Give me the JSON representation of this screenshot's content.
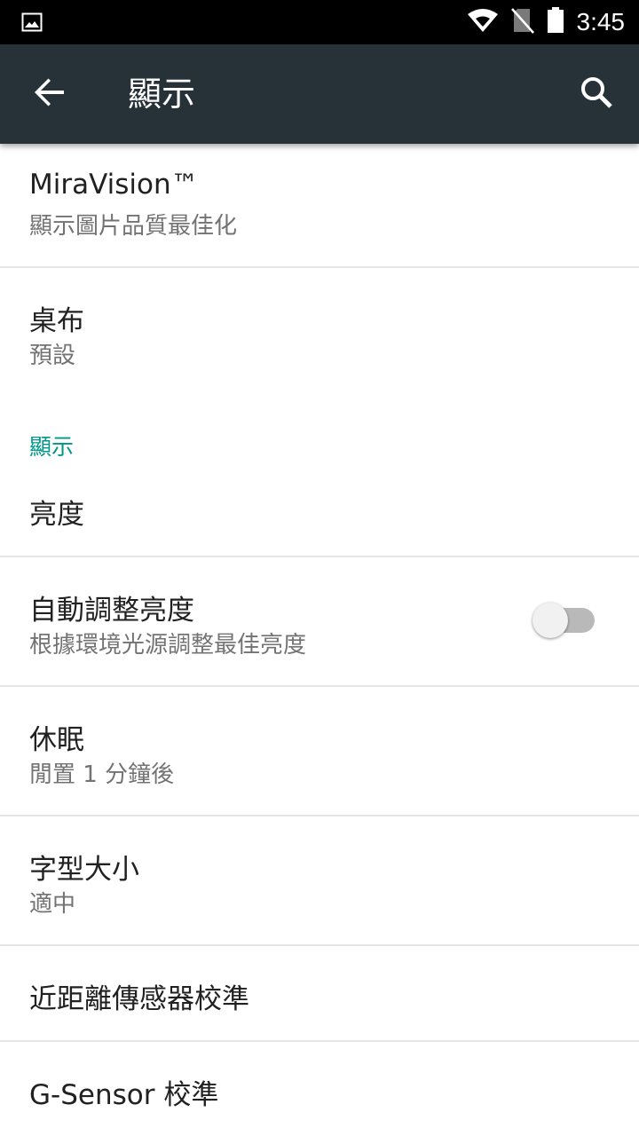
{
  "status_bar": {
    "time": "3:45",
    "icons": [
      "image-notification-icon",
      "wifi-icon",
      "no-sim-icon",
      "battery-icon"
    ]
  },
  "app_bar": {
    "title": "顯示",
    "back_icon": "arrow-back-icon",
    "search_icon": "search-icon",
    "background": "#263238"
  },
  "preferences": {
    "miravision": {
      "title": "MiraVision™",
      "summary": "顯示圖片品質最佳化"
    },
    "wallpaper": {
      "title": "桌布",
      "summary": "預設"
    },
    "display_category": {
      "title": "顯示",
      "color": "#009688"
    },
    "brightness": {
      "title": "亮度"
    },
    "auto_brightness": {
      "title": "自動調整亮度",
      "summary": "根據環境光源調整最佳亮度",
      "enabled": false
    },
    "sleep": {
      "title": "休眠",
      "summary": "閒置 1 分鐘後"
    },
    "font_size": {
      "title": "字型大小",
      "summary": "適中"
    },
    "proximity": {
      "title": "近距離傳感器校準"
    },
    "gsensor": {
      "title": "G-Sensor 校準"
    }
  }
}
